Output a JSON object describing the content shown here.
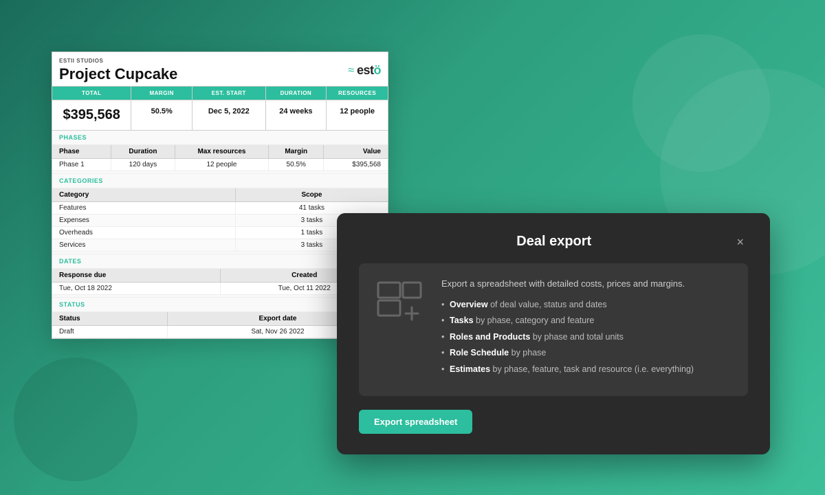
{
  "background": {
    "gradient_start": "#1a6b5a",
    "gradient_end": "#3dbf9a"
  },
  "spreadsheet": {
    "company": "ESTII STUDIOS",
    "title": "Project Cupcake",
    "logo_waves": "≈",
    "logo_name": "estö",
    "stats": {
      "headers": [
        "TOTAL",
        "MARGIN",
        "EST. START",
        "DURATION",
        "RESOURCES"
      ],
      "values": [
        "$395,568",
        "50.5%",
        "Dec 5, 2022",
        "24 weeks",
        "12 people"
      ]
    },
    "phases_label": "PHASES",
    "phases_headers": [
      "Phase",
      "Duration",
      "Max resources",
      "Margin",
      "Value"
    ],
    "phases_rows": [
      [
        "Phase 1",
        "120 days",
        "12 people",
        "50.5%",
        "$395,568"
      ]
    ],
    "categories_label": "CATEGORIES",
    "categories_headers": [
      "Category",
      "Scope"
    ],
    "categories_rows": [
      [
        "Features",
        "41 tasks"
      ],
      [
        "Expenses",
        "3 tasks"
      ],
      [
        "Overheads",
        "1 tasks"
      ],
      [
        "Services",
        "3 tasks"
      ]
    ],
    "dates_label": "DATES",
    "dates_headers": [
      "Response due",
      "Created"
    ],
    "dates_rows": [
      [
        "Tue, Oct 18 2022",
        "Tue, Oct 11 2022"
      ]
    ],
    "status_label": "STATUS",
    "status_headers": [
      "Status",
      "Export date"
    ],
    "status_rows": [
      [
        "Draft",
        "Sat, Nov 26 2022"
      ]
    ]
  },
  "modal": {
    "title": "Deal export",
    "close_label": "×",
    "description": "Export a spreadsheet with detailed costs, prices and margins.",
    "list_items": [
      {
        "bold": "Overview",
        "rest": " of deal value, status and dates"
      },
      {
        "bold": "Tasks",
        "rest": " by phase, category and feature"
      },
      {
        "bold": "Roles and Products",
        "rest": " by phase and total units"
      },
      {
        "bold": "Role Schedule",
        "rest": " by phase"
      },
      {
        "bold": "Estimates",
        "rest": " by phase, feature, task and resource (i.e. everything)"
      }
    ],
    "export_button": "Export spreadsheet"
  }
}
